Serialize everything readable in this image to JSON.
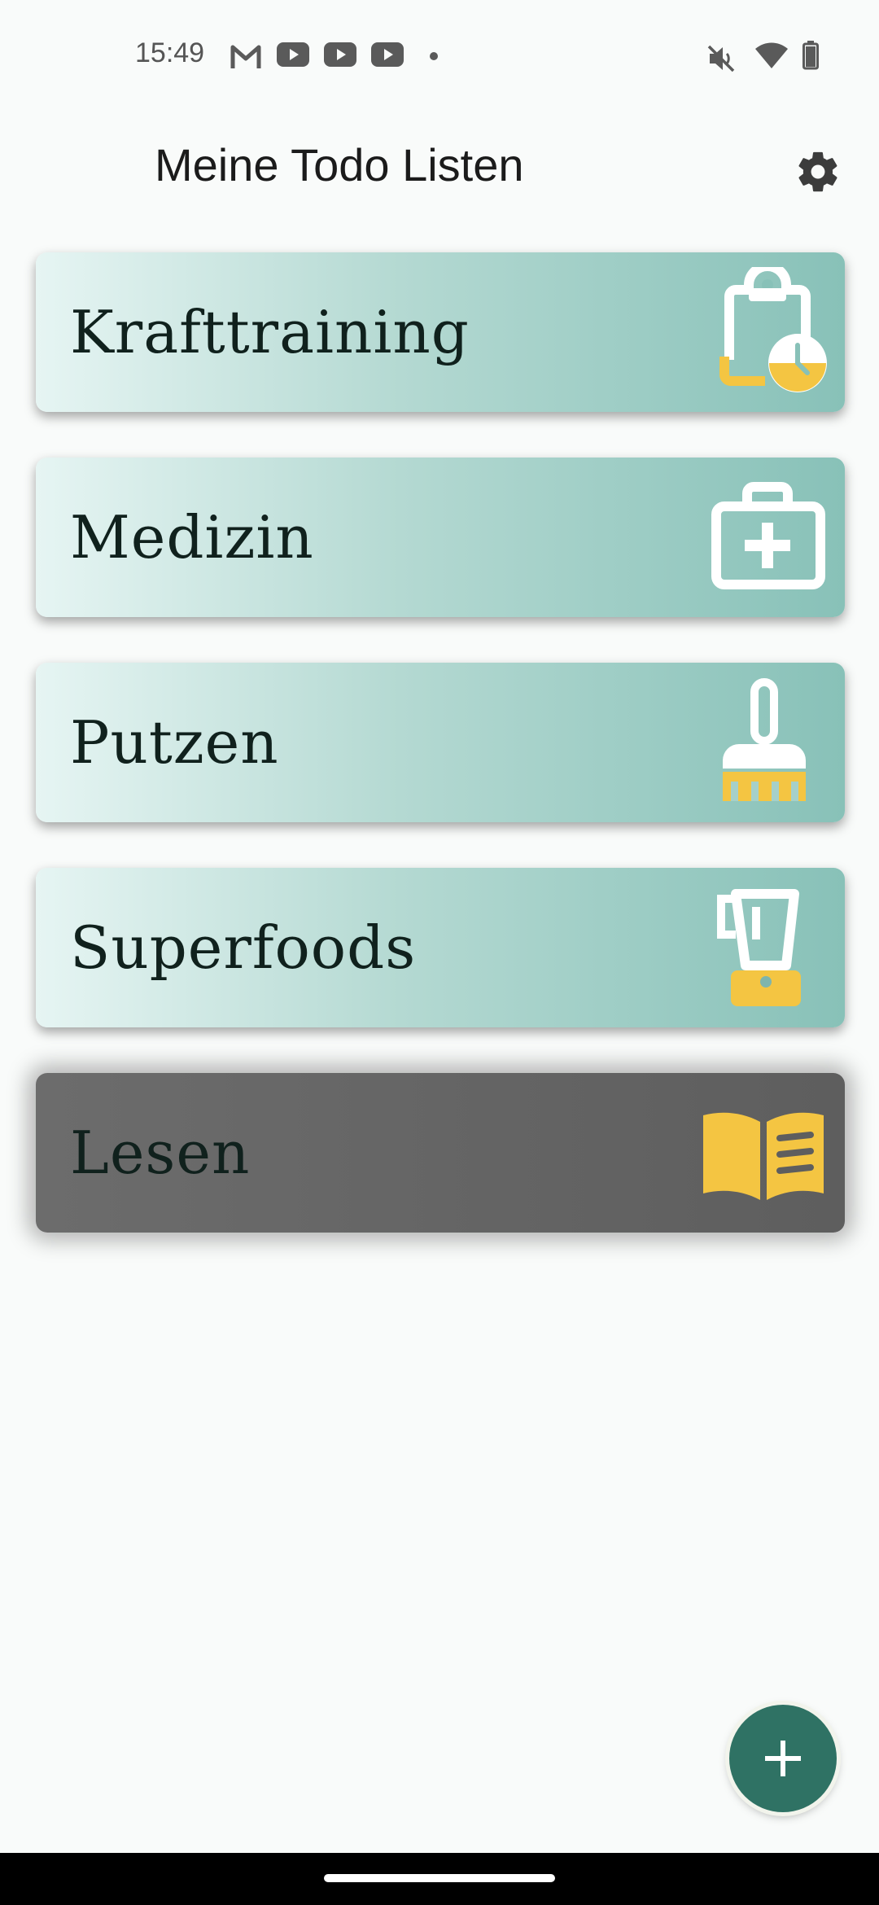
{
  "status_bar": {
    "time": "15:49",
    "icons": [
      "gmail-icon",
      "youtube-icon",
      "youtube-icon",
      "youtube-icon",
      "dot-icon",
      "mute-icon",
      "wifi-icon",
      "battery-icon"
    ]
  },
  "header": {
    "title": "Meine Todo Listen",
    "settings_icon": "gear-icon"
  },
  "lists": [
    {
      "label": "Krafttraining",
      "icon": "clipboard-clock-icon"
    },
    {
      "label": "Medizin",
      "icon": "medical-kit-icon"
    },
    {
      "label": "Putzen",
      "icon": "broom-icon"
    },
    {
      "label": "Superfoods",
      "icon": "blender-icon"
    },
    {
      "label": "Lesen",
      "icon": "open-book-icon",
      "state": "dimmed"
    }
  ],
  "fab": {
    "icon": "plus-icon"
  },
  "colors": {
    "accent": "#2f7264",
    "card_start": "#e6f5f3",
    "card_end": "#88c1b8",
    "icon_yellow": "#f4c542",
    "dimmed_card": "#616161"
  }
}
